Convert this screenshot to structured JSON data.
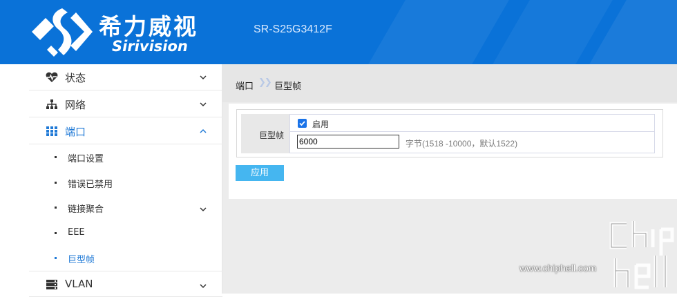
{
  "header": {
    "brand_cn": "希力威视",
    "brand_en": "Sirivision",
    "model": "SR-S25G3412F",
    "color": "#0a72d8"
  },
  "sidebar": {
    "items": [
      {
        "label": "状态",
        "icon": "heartbeat-icon",
        "expanded": false
      },
      {
        "label": "网络",
        "icon": "network-tree-icon",
        "expanded": false
      },
      {
        "label": "端口",
        "icon": "grid-icon",
        "expanded": true
      },
      {
        "label": "VLAN",
        "icon": "server-icon",
        "expanded": false
      }
    ],
    "sub_items": [
      {
        "label": "端口设置"
      },
      {
        "label": "错误已禁用"
      },
      {
        "label": "链接聚合",
        "has_children": true
      },
      {
        "label": "EEE"
      },
      {
        "label": "巨型帧",
        "active": true
      }
    ]
  },
  "breadcrumb": {
    "parent": "端口",
    "separator": "❯❯",
    "current": "巨型帧"
  },
  "form": {
    "field_label": "巨型帧",
    "enable_label": "启用",
    "enabled": true,
    "mtu_value": "6000",
    "hint": "字节(1518 -10000，默认1522)"
  },
  "actions": {
    "apply_label": "应用"
  },
  "watermark": {
    "text": "www.chiphell.com"
  },
  "colors": {
    "accent": "#1f79d6",
    "apply_button": "#45b6f0",
    "checkbox": "#1a73e8"
  }
}
